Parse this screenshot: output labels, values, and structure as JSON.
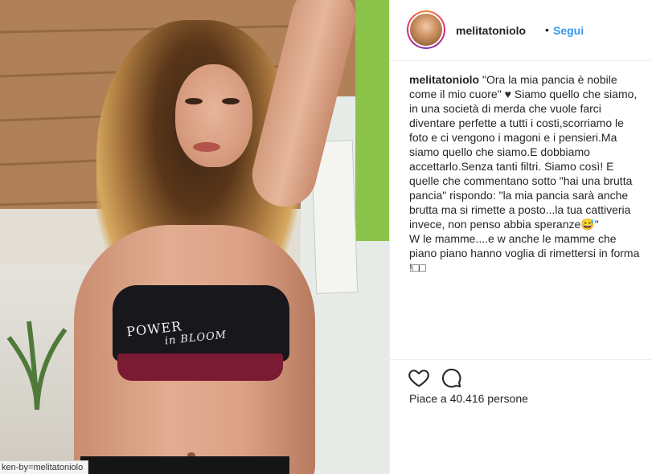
{
  "post": {
    "photo": {
      "print_line1": "POWER",
      "print_line2": "in BLOOM"
    },
    "status_url": "ken-by=melitatoniolo"
  },
  "header": {
    "username": "melitatoniolo",
    "separator": "•",
    "follow_label": "Segui"
  },
  "caption": {
    "username": "melitatoniolo",
    "text": " \"Ora la mia pancia è nobile come il mio cuore\" ♥ Siamo quello che siamo, in una società di merda che vuole farci diventare perfette a tutti i costi,scorriamo le foto e ci vengono i magoni e i pensieri.Ma siamo quello che siamo.E dobbiamo accettarlo.Senza tanti filtri. Siamo così! E quelle che commentano sotto \"hai una brutta pancia\" rispondo: \"la mia pancia sarà anche brutta ma si rimette a posto...la tua cattiveria invece, non penso abbia speranze😅\"\nW le mamme....e w anche le mamme che piano piano hanno voglia di rimettersi in forma !□□"
  },
  "actions": {
    "like_icon": "heart-outline-icon",
    "comment_icon": "speech-bubble-icon",
    "likes_text": "Piace a 40.416 persone"
  },
  "colors": {
    "link": "#3897f0",
    "text": "#262626",
    "border": "#efefef"
  }
}
